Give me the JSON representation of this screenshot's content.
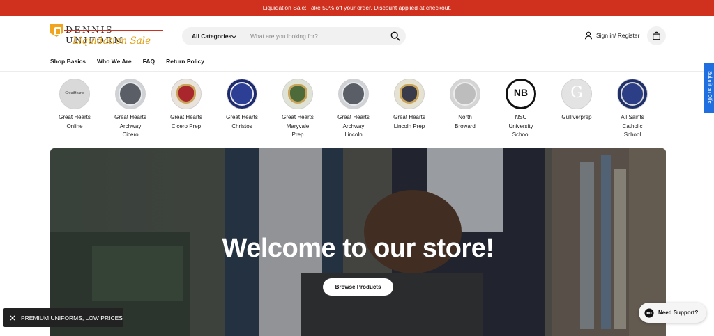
{
  "announcement": {
    "text": "Liquidation Sale: Take 50% off your order. Discount applied at checkout."
  },
  "logo": {
    "name": "DENNIS UNIFORM",
    "tagline": "Liquidation Sale"
  },
  "search": {
    "category_label": "All Categories",
    "placeholder": "What are you looking for?"
  },
  "account": {
    "signin_label": "Sign in/ Register"
  },
  "nav": {
    "items": [
      "Shop Basics",
      "Who We Are",
      "FAQ",
      "Return Policy"
    ]
  },
  "schools": [
    {
      "name": "Great Hearts Online",
      "lines": [
        "Great Hearts",
        "Online"
      ],
      "crest_text": "GreatHearts"
    },
    {
      "name": "Great Hearts Archway Cicero",
      "lines": [
        "Great Hearts",
        "Archway",
        "Cicero"
      ]
    },
    {
      "name": "Great Hearts Cicero Prep",
      "lines": [
        "Great Hearts",
        "Cicero Prep"
      ]
    },
    {
      "name": "Great Hearts Christos",
      "lines": [
        "Great Hearts",
        "Christos"
      ]
    },
    {
      "name": "Great Hearts Maryvale Prep",
      "lines": [
        "Great Hearts",
        "Maryvale",
        "Prep"
      ]
    },
    {
      "name": "Great Hearts Archway Lincoln",
      "lines": [
        "Great Hearts",
        "Archway",
        "Lincoln"
      ]
    },
    {
      "name": "Great Hearts Lincoln Prep",
      "lines": [
        "Great Hearts",
        "Lincoln Prep"
      ]
    },
    {
      "name": "North Broward",
      "lines": [
        "North",
        "Broward"
      ]
    },
    {
      "name": "NSU University School",
      "lines": [
        "NSU",
        "University",
        "School"
      ],
      "crest_text": "NB"
    },
    {
      "name": "Gulliverprep",
      "lines": [
        "Gulliverprep"
      ],
      "crest_text": "G"
    },
    {
      "name": "All Saints Catholic School",
      "lines": [
        "All Saints",
        "Catholic",
        "School"
      ]
    }
  ],
  "hero": {
    "title": "Welcome to our store!",
    "button_label": "Browse Products"
  },
  "side_tab": {
    "label": "Submit an Offer"
  },
  "promo_bar": {
    "label": "PREMIUM UNIFORMS, LOW PRICES"
  },
  "support": {
    "label": "Need Support?"
  },
  "colors": {
    "announcement_bg": "#d0311f",
    "logo_gold": "#e0a018",
    "side_tab_bg": "#1f6fe0"
  }
}
